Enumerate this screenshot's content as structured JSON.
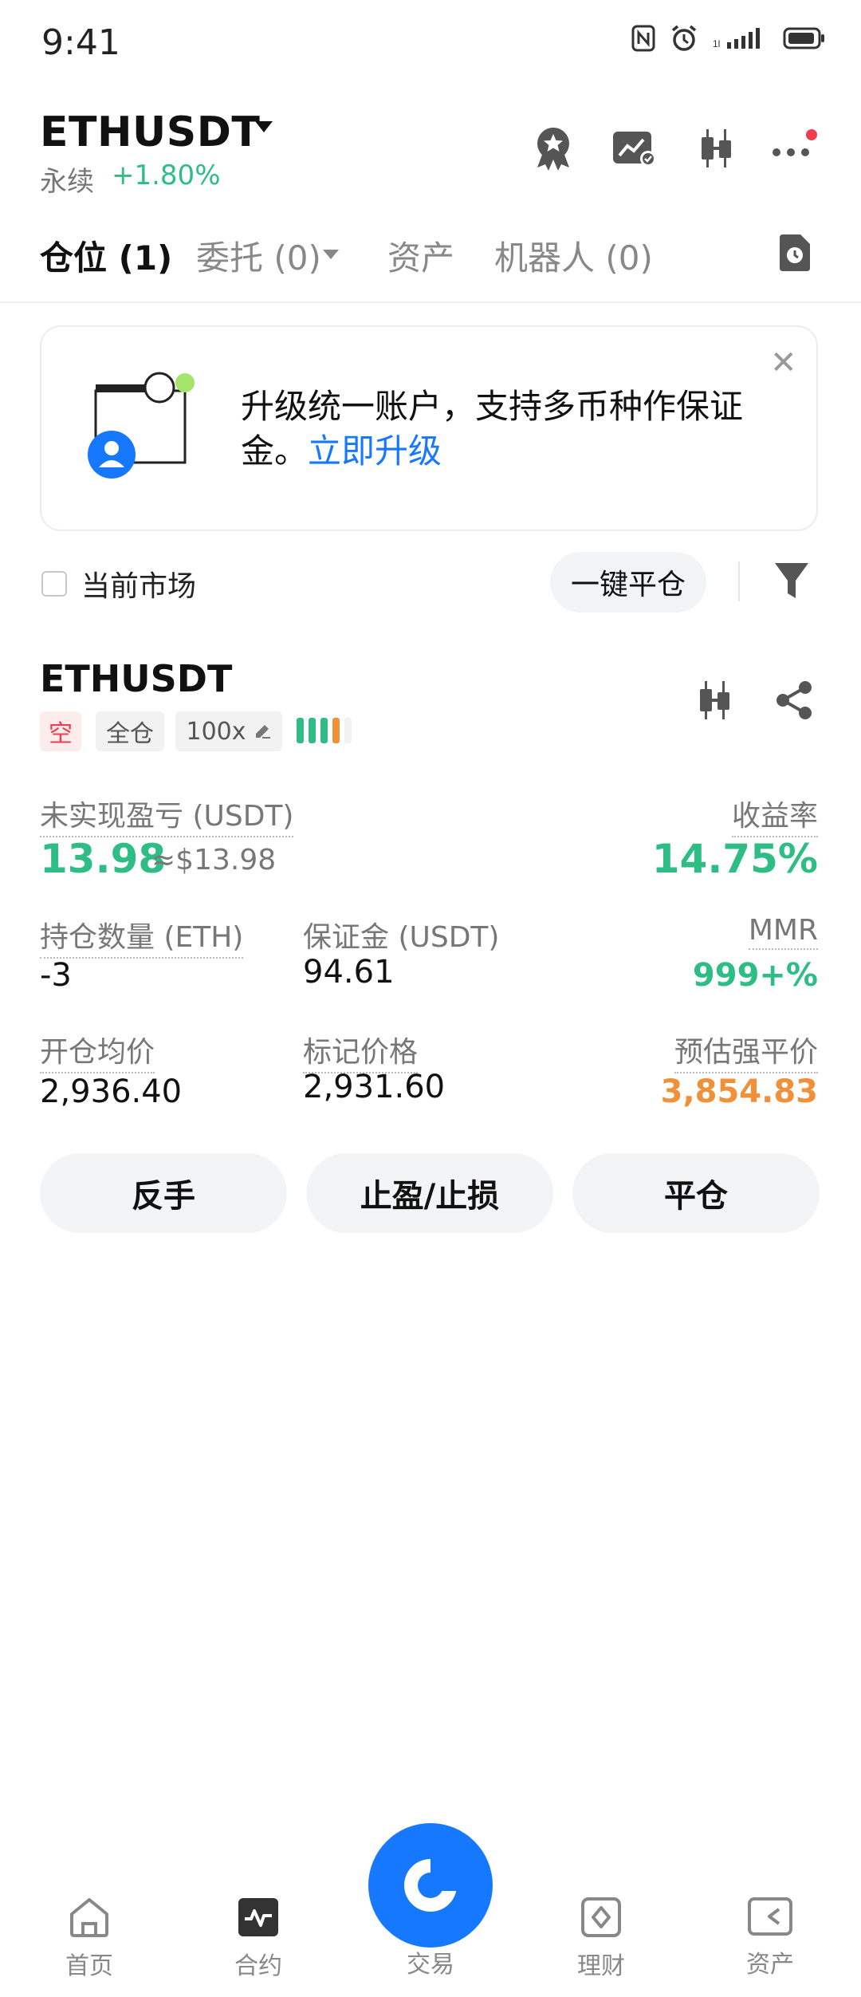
{
  "status_bar": {
    "time": "9:41"
  },
  "header": {
    "pair": "ETHUSDT",
    "perp_label": "永续",
    "change": "+1.80%"
  },
  "tabs": [
    {
      "label": "仓位 (1)"
    },
    {
      "label": "委托 (0)"
    },
    {
      "label": "资产"
    },
    {
      "label": "机器人 (0)"
    }
  ],
  "banner": {
    "text": "升级统一账户，支持多币种作保证金。",
    "link": "立即升级"
  },
  "filter": {
    "current_market_label": "当前市场",
    "one_click_close": "一键平仓"
  },
  "position": {
    "symbol": "ETHUSDT",
    "side_tag": "空",
    "margin_mode_tag": "全仓",
    "leverage_tag": "100x",
    "risk_level": 4,
    "unrealized_pnl_label": "未实现盈亏 (USDT)",
    "unrealized_pnl": "13.98",
    "unrealized_pnl_usd": "≈$13.98",
    "roi_label": "收益率",
    "roi": "14.75%",
    "size_label": "持仓数量 (ETH)",
    "size": "-3",
    "margin_label": "保证金 (USDT)",
    "margin": "94.61",
    "mmr_label": "MMR",
    "mmr": "999+%",
    "entry_price_label": "开仓均价",
    "entry_price": "2,936.40",
    "mark_price_label": "标记价格",
    "mark_price": "2,931.60",
    "liq_price_label": "预估强平价",
    "liq_price": "3,854.83"
  },
  "actions": {
    "reverse": "反手",
    "tp_sl": "止盈/止损",
    "close": "平仓"
  },
  "bottom_nav": [
    {
      "label": "首页",
      "icon": "home-icon"
    },
    {
      "label": "合约",
      "icon": "futures-icon"
    },
    {
      "label": "交易",
      "icon": "trade-icon"
    },
    {
      "label": "理财",
      "icon": "earn-icon"
    },
    {
      "label": "资产",
      "icon": "wallet-icon"
    }
  ],
  "colors": {
    "accent": "#1677ff",
    "up": "#2ebd85",
    "down": "#f23d4f",
    "liq": "#f0913a"
  }
}
